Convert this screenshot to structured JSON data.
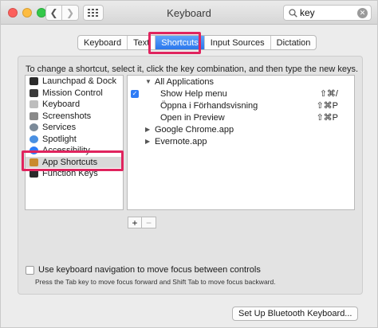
{
  "window": {
    "title": "Keyboard"
  },
  "search": {
    "value": "key"
  },
  "tabs": [
    {
      "label": "Keyboard",
      "active": false
    },
    {
      "label": "Text",
      "active": false
    },
    {
      "label": "Shortcuts",
      "active": true
    },
    {
      "label": "Input Sources",
      "active": false
    },
    {
      "label": "Dictation",
      "active": false
    }
  ],
  "instruction": "To change a shortcut, select it, click the key combination, and then type the new keys.",
  "categories": [
    {
      "label": "Launchpad & Dock",
      "icon": "launchpad-icon",
      "color": "#2b2b2b"
    },
    {
      "label": "Mission Control",
      "icon": "mission-control-icon",
      "color": "#3a3a3a"
    },
    {
      "label": "Keyboard",
      "icon": "keyboard-icon",
      "color": "#bdbdbd"
    },
    {
      "label": "Screenshots",
      "icon": "screenshot-icon",
      "color": "#8a8a8a"
    },
    {
      "label": "Services",
      "icon": "gear-icon",
      "color": "#7b8a99"
    },
    {
      "label": "Spotlight",
      "icon": "spotlight-icon",
      "color": "#4a90e2"
    },
    {
      "label": "Accessibility",
      "icon": "accessibility-icon",
      "color": "#2f7cf6"
    },
    {
      "label": "App Shortcuts",
      "icon": "app-shortcuts-icon",
      "color": "#c98a2e",
      "selected": true
    },
    {
      "label": "Function Keys",
      "icon": "function-keys-icon",
      "color": "#2b2b2b"
    }
  ],
  "shortcuts": [
    {
      "label": "All Applications",
      "expanded": true,
      "level": 0,
      "shortcut": ""
    },
    {
      "label": "Show Help menu",
      "level": 1,
      "checked": true,
      "shortcut": "⇧⌘/"
    },
    {
      "label": "Öppna i Förhandsvisning",
      "level": 1,
      "checked": false,
      "shortcut": "⇧⌘P"
    },
    {
      "label": "Open in Preview",
      "level": 1,
      "checked": false,
      "shortcut": "⇧⌘P"
    },
    {
      "label": "Google Chrome.app",
      "expanded": false,
      "level": 0,
      "shortcut": ""
    },
    {
      "label": "Evernote.app",
      "expanded": false,
      "level": 0,
      "shortcut": ""
    }
  ],
  "buttons": {
    "add": "+",
    "remove": "−"
  },
  "keyboard_nav": {
    "label": "Use keyboard navigation to move focus between controls",
    "hint": "Press the Tab key to move focus forward and Shift Tab to move focus backward."
  },
  "bluetooth_button": "Set Up Bluetooth Keyboard...",
  "colors": {
    "accent": "#2a76ec",
    "highlight": "#e0245e"
  }
}
